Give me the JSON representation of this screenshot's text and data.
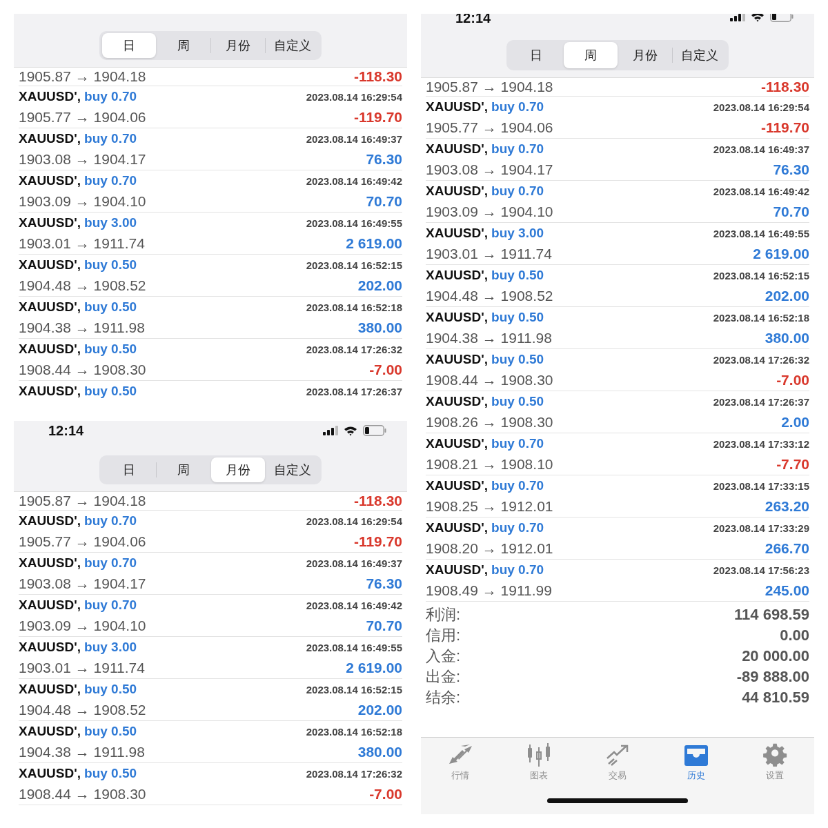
{
  "panels": [
    {
      "tabs": [
        {
          "label": "日",
          "selected": true
        },
        {
          "label": "周",
          "selected": false
        },
        {
          "label": "月份",
          "selected": false
        },
        {
          "label": "自定义",
          "selected": false
        }
      ],
      "top_row": {
        "prices": "1905.87 → 1904.18",
        "profit": "-118.30",
        "loss": true
      },
      "trades": [
        {
          "symbol": "XAUUSD',",
          "order": "buy 0.70",
          "time": "2023.08.14 16:29:54",
          "prices": "1905.77 → 1904.06",
          "profit": "-119.70",
          "loss": true
        },
        {
          "symbol": "XAUUSD',",
          "order": "buy 0.70",
          "time": "2023.08.14 16:49:37",
          "prices": "1903.08 → 1904.17",
          "profit": "76.30",
          "loss": false
        },
        {
          "symbol": "XAUUSD',",
          "order": "buy 0.70",
          "time": "2023.08.14 16:49:42",
          "prices": "1903.09 → 1904.10",
          "profit": "70.70",
          "loss": false
        },
        {
          "symbol": "XAUUSD',",
          "order": "buy 3.00",
          "time": "2023.08.14 16:49:55",
          "prices": "1903.01 → 1911.74",
          "profit": "2 619.00",
          "loss": false
        },
        {
          "symbol": "XAUUSD',",
          "order": "buy 0.50",
          "time": "2023.08.14 16:52:15",
          "prices": "1904.48 → 1908.52",
          "profit": "202.00",
          "loss": false
        },
        {
          "symbol": "XAUUSD',",
          "order": "buy 0.50",
          "time": "2023.08.14 16:52:18",
          "prices": "1904.38 → 1911.98",
          "profit": "380.00",
          "loss": false
        },
        {
          "symbol": "XAUUSD',",
          "order": "buy 0.50",
          "time": "2023.08.14 17:26:32",
          "prices": "1908.44 → 1908.30",
          "profit": "-7.00",
          "loss": true
        },
        {
          "symbol": "XAUUSD',",
          "order": "buy 0.50",
          "time": "2023.08.14 17:26:37"
        }
      ]
    },
    {
      "status_bar": {
        "time": "12:14"
      },
      "tabs": [
        {
          "label": "日",
          "selected": false
        },
        {
          "label": "周",
          "selected": false
        },
        {
          "label": "月份",
          "selected": true
        },
        {
          "label": "自定义",
          "selected": false
        }
      ],
      "top_row": {
        "prices": "1905.87 → 1904.18",
        "profit": "-118.30",
        "loss": true
      },
      "trades": [
        {
          "symbol": "XAUUSD',",
          "order": "buy 0.70",
          "time": "2023.08.14 16:29:54",
          "prices": "1905.77 → 1904.06",
          "profit": "-119.70",
          "loss": true
        },
        {
          "symbol": "XAUUSD',",
          "order": "buy 0.70",
          "time": "2023.08.14 16:49:37",
          "prices": "1903.08 → 1904.17",
          "profit": "76.30",
          "loss": false
        },
        {
          "symbol": "XAUUSD',",
          "order": "buy 0.70",
          "time": "2023.08.14 16:49:42",
          "prices": "1903.09 → 1904.10",
          "profit": "70.70",
          "loss": false
        },
        {
          "symbol": "XAUUSD',",
          "order": "buy 3.00",
          "time": "2023.08.14 16:49:55",
          "prices": "1903.01 → 1911.74",
          "profit": "2 619.00",
          "loss": false
        },
        {
          "symbol": "XAUUSD',",
          "order": "buy 0.50",
          "time": "2023.08.14 16:52:15",
          "prices": "1904.48 → 1908.52",
          "profit": "202.00",
          "loss": false
        },
        {
          "symbol": "XAUUSD',",
          "order": "buy 0.50",
          "time": "2023.08.14 16:52:18",
          "prices": "1904.38 → 1911.98",
          "profit": "380.00",
          "loss": false
        },
        {
          "symbol": "XAUUSD',",
          "order": "buy 0.50",
          "time": "2023.08.14 17:26:32",
          "prices": "1908.44 → 1908.30",
          "profit": "-7.00",
          "loss": true
        }
      ]
    },
    {
      "status_bar": {
        "time": "12:14"
      },
      "tabs": [
        {
          "label": "日",
          "selected": false
        },
        {
          "label": "周",
          "selected": true
        },
        {
          "label": "月份",
          "selected": false
        },
        {
          "label": "自定义",
          "selected": false
        }
      ],
      "top_row": {
        "prices": "1905.87 → 1904.18",
        "profit": "-118.30",
        "loss": true
      },
      "trades": [
        {
          "symbol": "XAUUSD',",
          "order": "buy 0.70",
          "time": "2023.08.14 16:29:54",
          "prices": "1905.77 → 1904.06",
          "profit": "-119.70",
          "loss": true
        },
        {
          "symbol": "XAUUSD',",
          "order": "buy 0.70",
          "time": "2023.08.14 16:49:37",
          "prices": "1903.08 → 1904.17",
          "profit": "76.30",
          "loss": false
        },
        {
          "symbol": "XAUUSD',",
          "order": "buy 0.70",
          "time": "2023.08.14 16:49:42",
          "prices": "1903.09 → 1904.10",
          "profit": "70.70",
          "loss": false
        },
        {
          "symbol": "XAUUSD',",
          "order": "buy 3.00",
          "time": "2023.08.14 16:49:55",
          "prices": "1903.01 → 1911.74",
          "profit": "2 619.00",
          "loss": false
        },
        {
          "symbol": "XAUUSD',",
          "order": "buy 0.50",
          "time": "2023.08.14 16:52:15",
          "prices": "1904.48 → 1908.52",
          "profit": "202.00",
          "loss": false
        },
        {
          "symbol": "XAUUSD',",
          "order": "buy 0.50",
          "time": "2023.08.14 16:52:18",
          "prices": "1904.38 → 1911.98",
          "profit": "380.00",
          "loss": false
        },
        {
          "symbol": "XAUUSD',",
          "order": "buy 0.50",
          "time": "2023.08.14 17:26:32",
          "prices": "1908.44 → 1908.30",
          "profit": "-7.00",
          "loss": true
        },
        {
          "symbol": "XAUUSD',",
          "order": "buy 0.50",
          "time": "2023.08.14 17:26:37",
          "prices": "1908.26 → 1908.30",
          "profit": "2.00",
          "loss": false
        },
        {
          "symbol": "XAUUSD',",
          "order": "buy 0.70",
          "time": "2023.08.14 17:33:12",
          "prices": "1908.21 → 1908.10",
          "profit": "-7.70",
          "loss": true
        },
        {
          "symbol": "XAUUSD',",
          "order": "buy 0.70",
          "time": "2023.08.14 17:33:15",
          "prices": "1908.25 → 1912.01",
          "profit": "263.20",
          "loss": false
        },
        {
          "symbol": "XAUUSD',",
          "order": "buy 0.70",
          "time": "2023.08.14 17:33:29",
          "prices": "1908.20 → 1912.01",
          "profit": "266.70",
          "loss": false
        },
        {
          "symbol": "XAUUSD',",
          "order": "buy 0.70",
          "time": "2023.08.14 17:56:23",
          "prices": "1908.49 → 1911.99",
          "profit": "245.00",
          "loss": false
        }
      ],
      "summary": [
        {
          "label": "利润:",
          "value": "114 698.59"
        },
        {
          "label": "信用:",
          "value": "0.00"
        },
        {
          "label": "入金:",
          "value": "20 000.00"
        },
        {
          "label": "出金:",
          "value": "-89 888.00"
        },
        {
          "label": "结余:",
          "value": "44 810.59"
        }
      ],
      "tab_bar": [
        {
          "label": "行情",
          "selected": false
        },
        {
          "label": "图表",
          "selected": false
        },
        {
          "label": "交易",
          "selected": false
        },
        {
          "label": "历史",
          "selected": true
        },
        {
          "label": "设置",
          "selected": false
        }
      ]
    }
  ]
}
